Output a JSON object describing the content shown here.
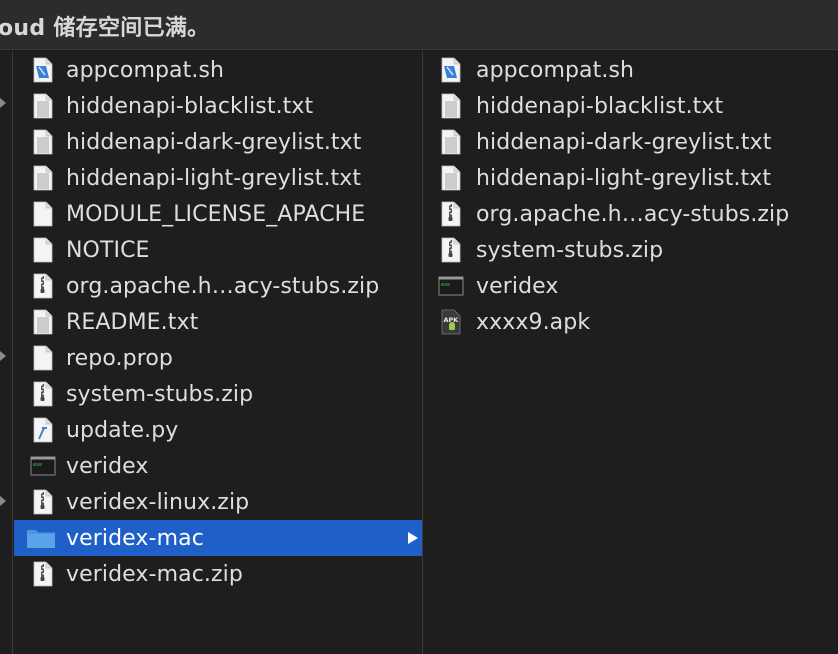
{
  "notice": {
    "text": "oud 储存空间已满。"
  },
  "column_middle": {
    "items": [
      {
        "name": "appcompat.sh",
        "icon": "shell-script-icon"
      },
      {
        "name": "hiddenapi-blacklist.txt",
        "icon": "text-file-icon"
      },
      {
        "name": "hiddenapi-dark-greylist.txt",
        "icon": "text-file-icon"
      },
      {
        "name": "hiddenapi-light-greylist.txt",
        "icon": "text-file-icon"
      },
      {
        "name": "MODULE_LICENSE_APACHE",
        "icon": "blank-file-icon"
      },
      {
        "name": "NOTICE",
        "icon": "blank-file-icon"
      },
      {
        "name": "org.apache.h…acy-stubs.zip",
        "icon": "zip-file-icon"
      },
      {
        "name": "README.txt",
        "icon": "text-file-icon"
      },
      {
        "name": "repo.prop",
        "icon": "blank-file-icon"
      },
      {
        "name": "system-stubs.zip",
        "icon": "zip-file-icon"
      },
      {
        "name": "update.py",
        "icon": "python-file-icon"
      },
      {
        "name": "veridex",
        "icon": "executable-icon"
      },
      {
        "name": "veridex-linux.zip",
        "icon": "zip-file-icon"
      },
      {
        "name": "veridex-mac",
        "icon": "folder-icon",
        "selected": true
      },
      {
        "name": "veridex-mac.zip",
        "icon": "zip-file-icon"
      }
    ]
  },
  "column_right": {
    "items": [
      {
        "name": "appcompat.sh",
        "icon": "shell-script-icon"
      },
      {
        "name": "hiddenapi-blacklist.txt",
        "icon": "text-file-icon"
      },
      {
        "name": "hiddenapi-dark-greylist.txt",
        "icon": "text-file-icon"
      },
      {
        "name": "hiddenapi-light-greylist.txt",
        "icon": "text-file-icon"
      },
      {
        "name": "org.apache.h…acy-stubs.zip",
        "icon": "zip-file-icon"
      },
      {
        "name": "system-stubs.zip",
        "icon": "zip-file-icon"
      },
      {
        "name": "veridex",
        "icon": "executable-icon"
      },
      {
        "name": "xxxx9.apk",
        "icon": "apk-file-icon"
      }
    ]
  },
  "icon_labels": {
    "apk": "APK"
  },
  "colors": {
    "selection": "#1f5fc8",
    "folder": "#5aa3e8",
    "background": "#1e1e1e"
  }
}
